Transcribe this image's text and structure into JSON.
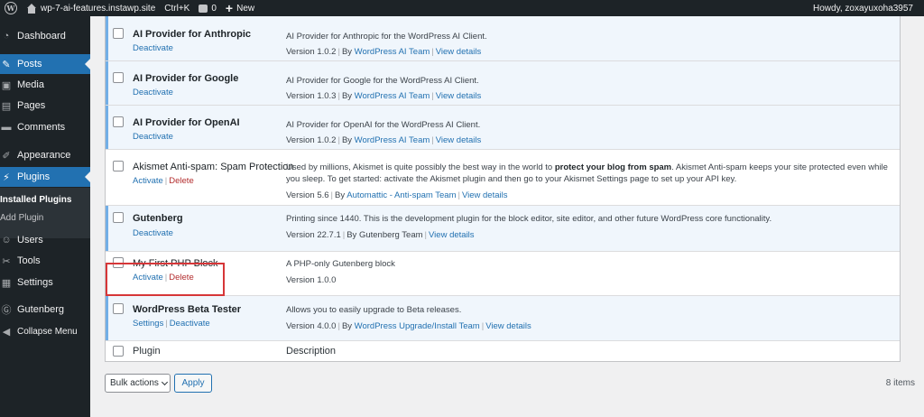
{
  "adminbar": {
    "site_name": "wp-7-ai-features.instawp.site",
    "shortcut": "Ctrl+K",
    "comments_count": "0",
    "new_label": "New",
    "howdy": "Howdy, zoxayuxoha3957"
  },
  "sidebar": {
    "dashboard": "Dashboard",
    "posts": "Posts",
    "media": "Media",
    "pages": "Pages",
    "comments": "Comments",
    "appearance": "Appearance",
    "plugins": "Plugins",
    "installed_plugins": "Installed Plugins",
    "add_plugin": "Add Plugin",
    "users": "Users",
    "tools": "Tools",
    "settings": "Settings",
    "gutenberg": "Gutenberg",
    "collapse": "Collapse Menu"
  },
  "plugins": [
    {
      "name": "AI Provider for Anthropic",
      "actions": [
        "Deactivate"
      ],
      "description": "AI Provider for Anthropic for the WordPress AI Client.",
      "version": "Version 1.0.2",
      "by": "By",
      "author": "WordPress AI Team",
      "details": "View details"
    },
    {
      "name": "AI Provider for Google",
      "actions": [
        "Deactivate"
      ],
      "description": "AI Provider for Google for the WordPress AI Client.",
      "version": "Version 1.0.3",
      "by": "By",
      "author": "WordPress AI Team",
      "details": "View details"
    },
    {
      "name": "AI Provider for OpenAI",
      "actions": [
        "Deactivate"
      ],
      "description": "AI Provider for OpenAI for the WordPress AI Client.",
      "version": "Version 1.0.2",
      "by": "By",
      "author": "WordPress AI Team",
      "details": "View details"
    },
    {
      "name": "Akismet Anti-spam: Spam Protection",
      "actions": [
        "Activate",
        "Delete"
      ],
      "description_pre": "Used by millions, Akismet is quite possibly the best way in the world to",
      "description_bold": "protect your blog from spam",
      "description_post": ". Akismet Anti-spam keeps your site protected even while you sleep. To get started: activate the Akismet plugin and then go to your Akismet Settings page to set up your API key.",
      "version": "Version 5.6",
      "by": "By",
      "author": "Automattic - Anti-spam Team",
      "details": "View details"
    },
    {
      "name": "Gutenberg",
      "actions": [
        "Deactivate"
      ],
      "description": "Printing since 1440. This is the development plugin for the block editor, site editor, and other future WordPress core functionality.",
      "version": "Version 22.7.1",
      "by_text": "By Gutenberg Team",
      "details": "View details"
    },
    {
      "name": "My First PHP Block",
      "actions": [
        "Activate",
        "Delete"
      ],
      "description": "A PHP-only Gutenberg block",
      "version": "Version 1.0.0"
    },
    {
      "name": "WordPress Beta Tester",
      "actions": [
        "Settings",
        "Deactivate"
      ],
      "description": "Allows you to easily upgrade to Beta releases.",
      "version": "Version 4.0.0",
      "by": "By",
      "author": "WordPress Upgrade/Install Team",
      "details": "View details"
    }
  ],
  "footer": {
    "plugin_col": "Plugin",
    "description_col": "Description"
  },
  "bulk_actions": {
    "label": "Bulk actions",
    "apply": "Apply",
    "count": "8 items"
  },
  "colors": {
    "adminbar_bg": "#1d2327",
    "accent": "#2271b1",
    "active_row_bg": "#f0f6fc",
    "active_row_border": "#72aee6",
    "delete": "#b32d2e",
    "highlight": "#d63638"
  }
}
